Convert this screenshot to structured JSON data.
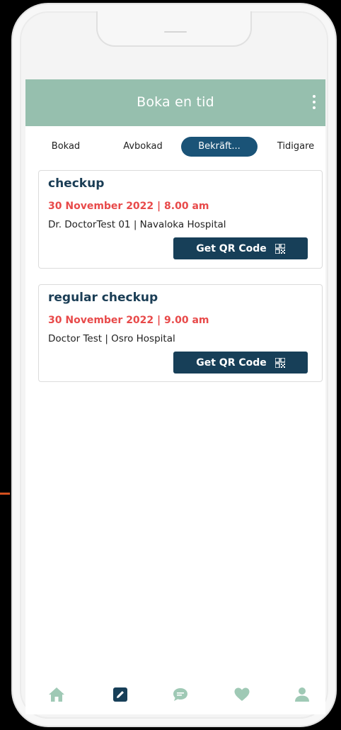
{
  "appbar": {
    "title": "Boka en tid",
    "menu_icon": "more-vertical-icon"
  },
  "tabs": [
    {
      "label": "Bokad",
      "active": false
    },
    {
      "label": "Avbokad",
      "active": false
    },
    {
      "label": "Bekräft...",
      "active": true
    },
    {
      "label": "Tidigare",
      "active": false
    }
  ],
  "appointments": [
    {
      "title": "checkup",
      "datetime": "30 November 2022 | 8.00 am",
      "doctor_hospital": "Dr. DoctorTest 01 | Navaloka Hospital",
      "button_label": "Get QR Code",
      "button_icon": "qr-code-icon"
    },
    {
      "title": "regular checkup",
      "datetime": "30 November 2022 | 9.00 am",
      "doctor_hospital": "Doctor Test | Osro Hospital",
      "button_label": "Get QR Code",
      "button_icon": "qr-code-icon"
    }
  ],
  "bottom_nav": [
    {
      "icon": "home-icon"
    },
    {
      "icon": "edit-icon",
      "active": true
    },
    {
      "icon": "chat-icon"
    },
    {
      "icon": "heart-icon"
    },
    {
      "icon": "user-icon"
    }
  ],
  "colors": {
    "appbar": "#96bfae",
    "active_tab": "#1a5377",
    "date_text": "#e84a4a",
    "button": "#173f58",
    "nav_icon": "#9fc9b5",
    "nav_active": "#173f58"
  }
}
